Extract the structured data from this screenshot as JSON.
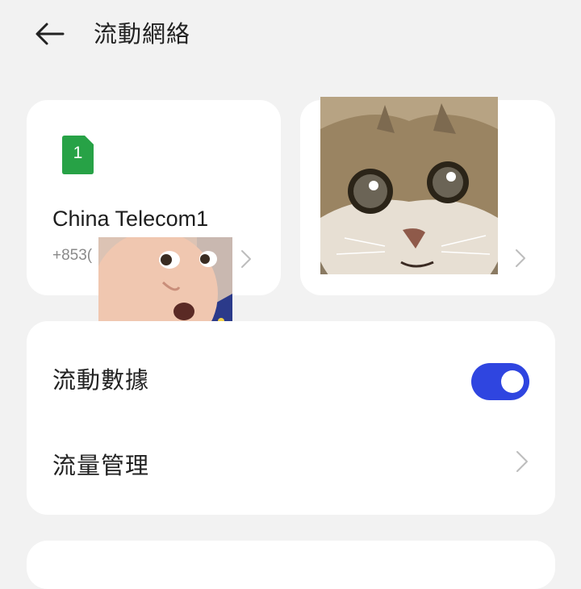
{
  "header": {
    "title": "流動網絡"
  },
  "sim_cards": [
    {
      "slot_label": "1",
      "name": "China Telecom1",
      "number": "+853(",
      "badge_color": "#27a246"
    },
    {
      "slot_label": "",
      "name": "",
      "number": ""
    }
  ],
  "settings": {
    "mobile_data": {
      "label": "流動數據",
      "enabled": true,
      "toggle_color": "#2f45e0"
    },
    "data_management": {
      "label": "流量管理"
    }
  },
  "overlays": [
    {
      "icon": "baby-face-sticker-icon"
    },
    {
      "icon": "cat-face-sticker-icon"
    }
  ]
}
